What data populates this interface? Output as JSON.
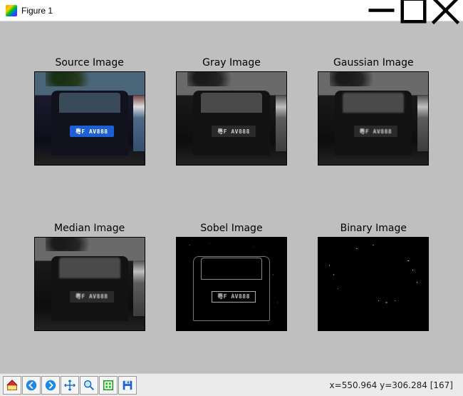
{
  "window": {
    "title": "Figure 1"
  },
  "subplots": [
    {
      "title": "Source Image",
      "plate": "粤F AV888"
    },
    {
      "title": "Gray Image",
      "plate": "粤F AV888"
    },
    {
      "title": "Gaussian Image",
      "plate": "粤F AV888"
    },
    {
      "title": "Median Image",
      "plate": "粤F AV888"
    },
    {
      "title": "Sobel Image",
      "plate": "粤F AV888"
    },
    {
      "title": "Binary Image",
      "plate": ""
    }
  ],
  "toolbar": {
    "home": "Home",
    "back": "Back",
    "forward": "Forward",
    "pan": "Pan",
    "zoom": "Zoom",
    "configure": "Configure subplots",
    "save": "Save"
  },
  "status": {
    "coords": "x=550.964    y=306.284    [167]"
  }
}
